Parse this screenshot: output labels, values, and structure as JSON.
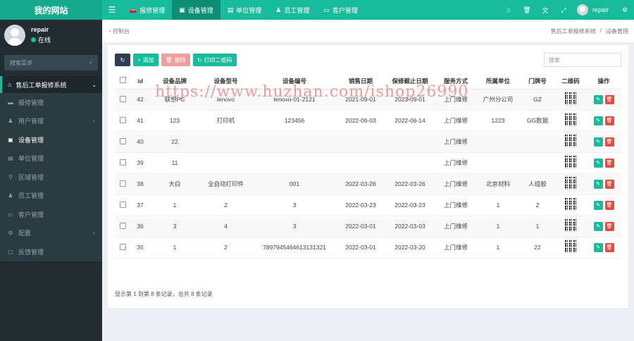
{
  "topbar": {
    "logo": "我的网站",
    "menu_toggle_icon": "hamburger-icon",
    "nav": [
      {
        "label": "报修管理",
        "icon": "car-icon",
        "active": false
      },
      {
        "label": "设备管理",
        "icon": "device-icon",
        "active": true
      },
      {
        "label": "单位管理",
        "icon": "building-icon",
        "active": false
      },
      {
        "label": "员工管理",
        "icon": "user-icon",
        "active": false
      },
      {
        "label": "客户管理",
        "icon": "address-card-icon",
        "active": false
      }
    ],
    "right_icons": [
      "home-icon",
      "trash-icon",
      "language-icon",
      "fullscreen-icon"
    ],
    "user": "repair",
    "settings_icon": "gears-icon",
    "accent_color": "#18bc9c"
  },
  "sidebar": {
    "user": {
      "name": "repair",
      "status": "在线"
    },
    "search_placeholder": "搜索菜单",
    "group": {
      "label": "售后工单报修系统"
    },
    "items": [
      {
        "label": "报修管理",
        "has_children": false,
        "active": false
      },
      {
        "label": "用户管理",
        "has_children": true,
        "active": false
      },
      {
        "label": "设备管理",
        "has_children": false,
        "active": true
      },
      {
        "label": "单位管理",
        "has_children": false,
        "active": false
      },
      {
        "label": "区域管理",
        "has_children": false,
        "active": false
      },
      {
        "label": "员工管理",
        "has_children": false,
        "active": false
      },
      {
        "label": "客户管理",
        "has_children": false,
        "active": false
      },
      {
        "label": "配置",
        "has_children": true,
        "active": false
      },
      {
        "label": "反馈管理",
        "has_children": false,
        "active": false
      }
    ]
  },
  "breadcrumb": {
    "left": "控制台",
    "right": [
      "售后工单报修系统",
      "设备管理"
    ]
  },
  "toolbar": {
    "refresh_icon": "refresh-icon",
    "add_label": "添加",
    "delete_label": "删除",
    "qrcode_label": "打印二维码",
    "search_placeholder": "搜索"
  },
  "table": {
    "headers": [
      "id",
      "设备品牌",
      "设备型号",
      "设备编号",
      "销售日期",
      "保修截止日期",
      "服务方式",
      "所属单位",
      "门牌号",
      "二维码",
      "操作"
    ],
    "rows": [
      [
        "42",
        "联想PC",
        "lenovo",
        "lenovo-01-2121",
        "2021-09-01",
        "2023-09-01",
        "上门维修",
        "广州分公司",
        "GZ"
      ],
      [
        "41",
        "123",
        "打印机",
        "123456",
        "2022-06-03",
        "2022-06-14",
        "上门维修",
        "1223",
        "GG数据"
      ],
      [
        "40",
        "22",
        "",
        "",
        "",
        "",
        "上门维修",
        "",
        ""
      ],
      [
        "39",
        "11",
        "",
        "",
        "",
        "",
        "上门维修",
        "",
        ""
      ],
      [
        "38",
        "大白",
        "全自动打印件",
        "001",
        "2022-03-26",
        "2022-03-26",
        "上门维修",
        "北京材料",
        "人组般"
      ],
      [
        "37",
        "1",
        "2",
        "3",
        "2022-03-23",
        "2022-03-23",
        "上门维修",
        "1",
        "2"
      ],
      [
        "36",
        "3",
        "4",
        "3",
        "2022-03-01",
        "2022-03-03",
        "上门维修",
        "1",
        "1"
      ],
      [
        "35",
        "1",
        "2",
        "7897945464613131321",
        "2022-03-01",
        "2022-03-20",
        "上门维修",
        "1",
        "22"
      ]
    ]
  },
  "footer_info": "显示第 1 到第 8 条记录，总共 8 条记录",
  "watermark": "https://www.huzhan.com/ishop26990"
}
